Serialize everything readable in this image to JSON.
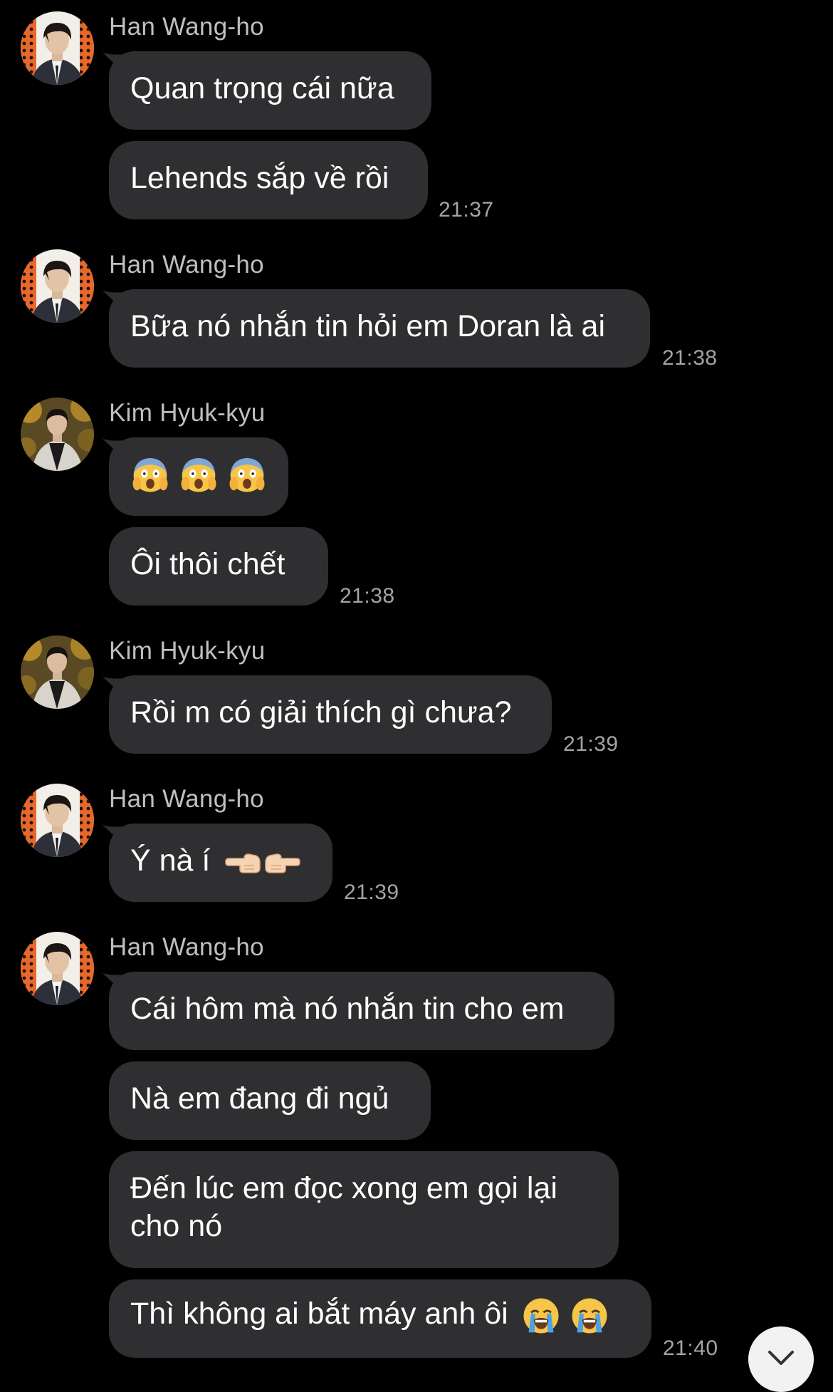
{
  "colors": {
    "background": "#000000",
    "bubble": "#2f2f31",
    "sender_name": "#bfbfbf",
    "timestamp": "#a4a4a4"
  },
  "messages": [
    {
      "sender": "Han Wang-ho",
      "avatar": "han-wang-ho-avatar",
      "bubbles": [
        "Quan trọng cái nữa",
        "Lehends sắp về rồi"
      ],
      "time": "21:37"
    },
    {
      "sender": "Han Wang-ho",
      "avatar": "han-wang-ho-avatar",
      "bubbles": [
        "Bữa nó nhắn tin hỏi em Doran là ai"
      ],
      "time": "21:38"
    },
    {
      "sender": "Kim Hyuk-kyu",
      "avatar": "kim-hyuk-kyu-avatar",
      "bubbles": [
        "scream-emoji x3",
        "Ôi thôi chết"
      ],
      "time": "21:38"
    },
    {
      "sender": "Kim Hyuk-kyu",
      "avatar": "kim-hyuk-kyu-avatar",
      "bubbles": [
        "Rồi m có giải thích gì chưa?"
      ],
      "time": "21:39"
    },
    {
      "sender": "Han Wang-ho",
      "avatar": "han-wang-ho-avatar",
      "bubbles": [
        "Ý nà í"
      ],
      "time": "21:39"
    },
    {
      "sender": "Han Wang-ho",
      "avatar": "han-wang-ho-avatar",
      "bubbles": [
        "Cái hôm mà nó nhắn tin cho em",
        "Nà em đang đi ngủ",
        "Đến lúc em đọc xong em gọi lại cho nó",
        "Thì không ai bắt máy anh ôi"
      ],
      "time": "21:40"
    }
  ],
  "icons": {
    "scream": "scream-emoji",
    "point_left": "point-left-emoji",
    "point_right": "point-right-emoji",
    "crying": "loudly-crying-emoji",
    "scroll_down": "chevron-down-icon"
  }
}
